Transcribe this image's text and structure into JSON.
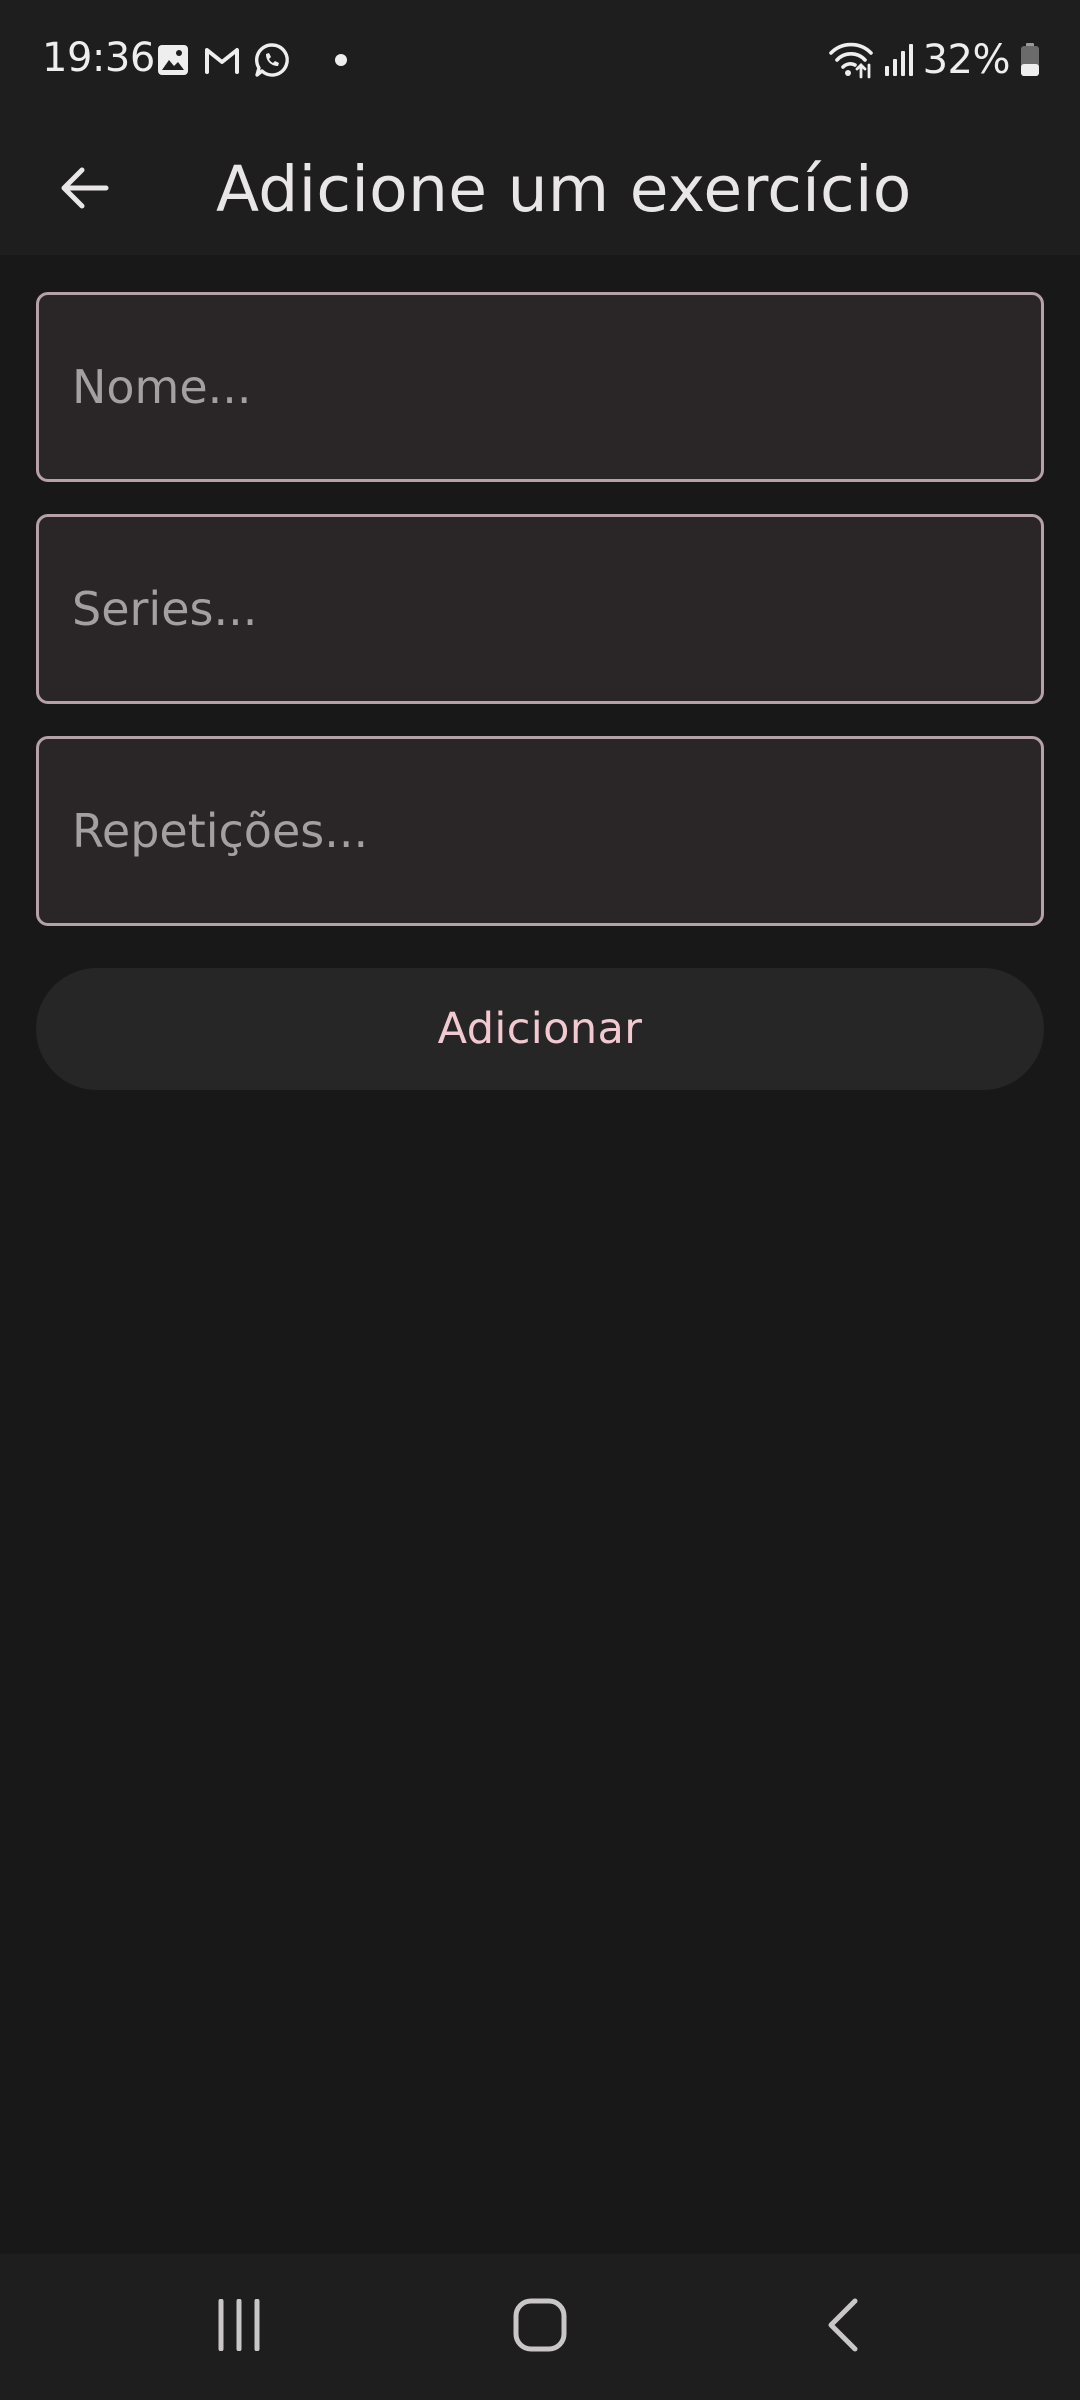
{
  "status_bar": {
    "time": "19:36",
    "battery": "32%",
    "icons_left": [
      "gallery-icon",
      "gmail-icon",
      "whatsapp-icon",
      "notification-dot-icon"
    ],
    "icons_right": [
      "wifi-icon",
      "signal-icon",
      "battery-icon"
    ]
  },
  "app_bar": {
    "title": "Adicione um exercício",
    "back_icon": "arrow-back-icon"
  },
  "form": {
    "name_placeholder": "Nome...",
    "series_placeholder": "Series...",
    "reps_placeholder": "Repetições...",
    "submit_label": "Adicionar"
  },
  "nav_bar": {
    "icons": [
      "recents-icon",
      "home-icon",
      "back-icon"
    ]
  },
  "colors": {
    "background": "#181818",
    "bar": "#1f1e1f",
    "field_fill": "#2a2627",
    "field_border": "#b5a1a6",
    "button_fill": "#272627",
    "accent_text": "#f2c9d0"
  }
}
